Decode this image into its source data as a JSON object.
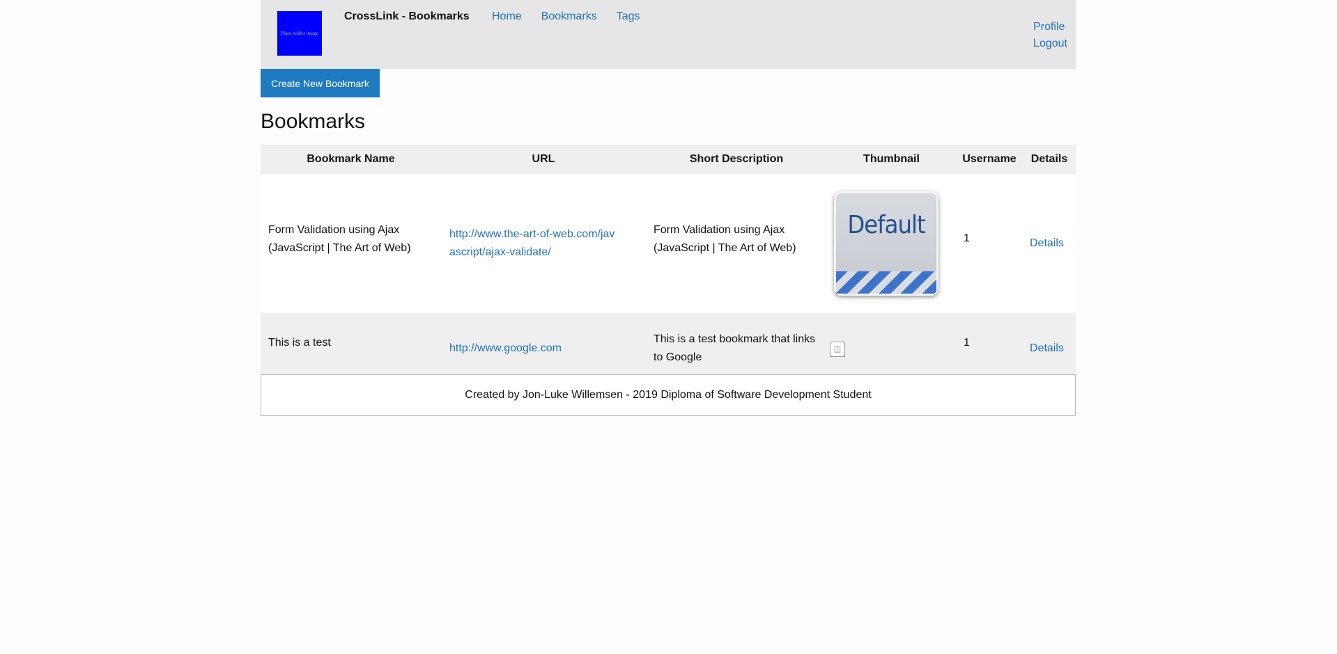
{
  "header": {
    "logo_text": "Place holder image",
    "brand": "CrossLink - Bookmarks",
    "nav": [
      "Home",
      "Bookmarks",
      "Tags"
    ],
    "user_nav": [
      "Profile",
      "Logout"
    ]
  },
  "actions": {
    "create_label": "Create New Bookmark"
  },
  "page_title": "Bookmarks",
  "table": {
    "columns": [
      "Bookmark Name",
      "URL",
      "Short Description",
      "Thumbnail",
      "Username",
      "Details"
    ],
    "rows": [
      {
        "name": "Form Validation using Ajax (JavaScript | The Art of Web)",
        "url": "http://www.the-art-of-web.com/javascript/ajax-validate/",
        "description": "Form Validation using Ajax (JavaScript | The Art of Web)",
        "thumbnail_text": "Default",
        "username": "1",
        "details": "Details"
      },
      {
        "name": "This is a test",
        "url": "http://www.google.com",
        "description": "This is a test bookmark that links to Google",
        "thumbnail_icon": "broken-image-icon",
        "username": "1",
        "details": "Details"
      }
    ]
  },
  "footer": {
    "text": "Created by Jon-Luke Willemsen - 2019 Diploma of Software Development Student"
  },
  "colors": {
    "header_bg": "#e6e6e6",
    "link": "#1f73b7",
    "button": "#1f7bc0",
    "logo": "#0000ff"
  }
}
